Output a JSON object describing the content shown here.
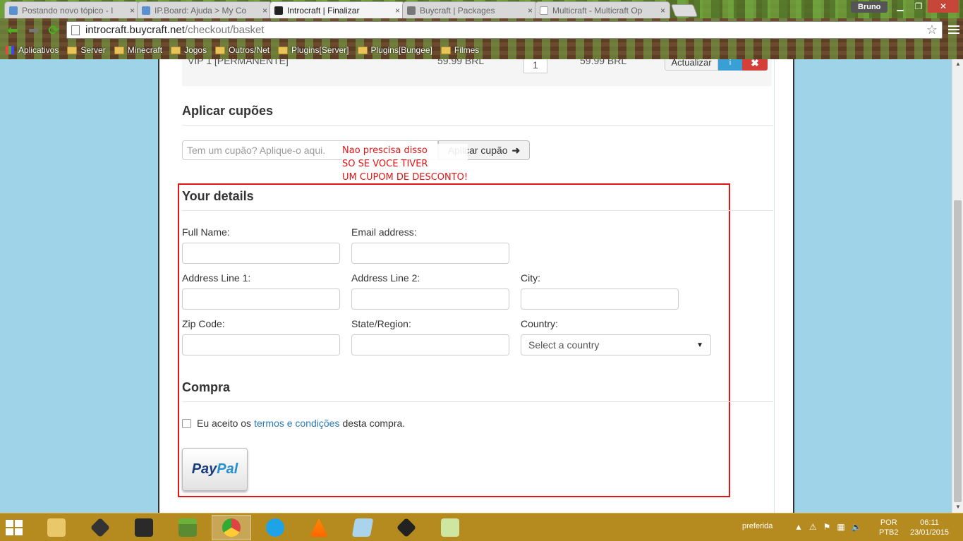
{
  "browser": {
    "tabs": [
      {
        "title": "Postando novo tópico - I",
        "icon": "vortex-icon",
        "active": false
      },
      {
        "title": "IP.Board: Ajuda > My Co",
        "icon": "vortex-icon",
        "active": false
      },
      {
        "title": "Introcraft | Finalizar",
        "icon": "buycraft-icon",
        "active": true
      },
      {
        "title": "Buycraft | Packages",
        "icon": "buycraft-icon",
        "active": false
      },
      {
        "title": "Multicraft - Multicraft Op",
        "icon": "page-icon",
        "active": false
      }
    ],
    "tab_close": "×",
    "user": "Bruno",
    "url_host": "introcraft.buycraft.net",
    "url_path": "/checkout/basket",
    "bookmarks": [
      "Aplicativos",
      "Server",
      "Minecraft",
      "Jogos",
      "Outros/Net",
      "Plugins[Server]",
      "Plugins[Bungee]",
      "Filmes"
    ]
  },
  "basket": {
    "item": "VIP 1 [PERMANENTE]",
    "price": "59.99 BRL",
    "quantity": "1",
    "total": "59.99 BRL",
    "update_label": "Actualizar",
    "info_label": "i",
    "delete_label": "✖"
  },
  "coupon": {
    "heading": "Aplicar cupões",
    "placeholder": "Tem um cupão? Aplique-o aqui.",
    "button_label": "Aplicar cupão",
    "annotation": [
      "Nao prescisa disso",
      "SO SE VOCE TIVER",
      "UM CUPOM DE DESCONTO!"
    ]
  },
  "details": {
    "heading": "Your details",
    "full_name": "Full Name:",
    "email": "Email address:",
    "address1": "Address Line 1:",
    "address2": "Address Line 2:",
    "city": "City:",
    "zip": "Zip Code:",
    "state": "State/Region:",
    "country": "Country:",
    "country_placeholder": "Select a country"
  },
  "purchase": {
    "heading": "Compra",
    "terms_before": "Eu aceito os",
    "terms_link": "termos e condições",
    "terms_after": "desta compra.",
    "paypal_pay": "Pay",
    "paypal_pal": "Pal"
  },
  "taskbar": {
    "tray_label": "preferida",
    "lang_top": "POR",
    "lang_bottom": "PTB2",
    "time": "06:11",
    "date": "23/01/2015"
  }
}
